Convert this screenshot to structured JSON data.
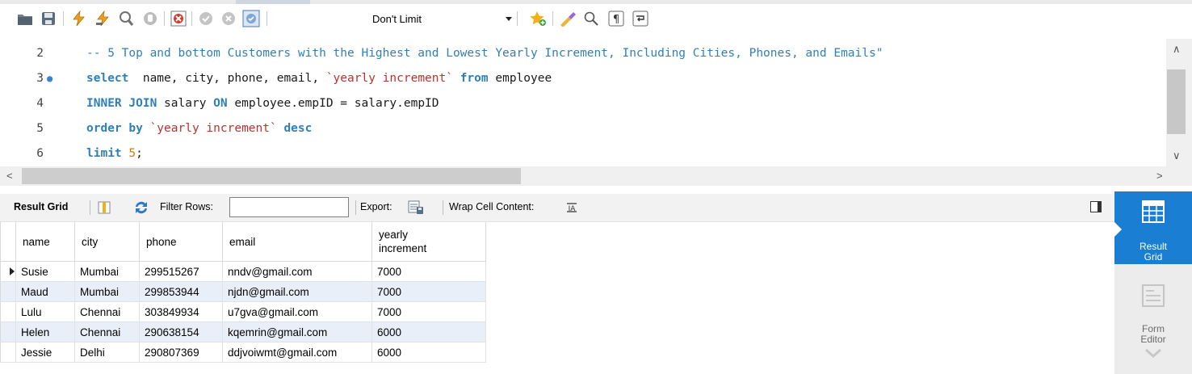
{
  "toolbar": {
    "limit_value": "Don't Limit",
    "icons": [
      "open-folder-icon",
      "save-icon",
      "execute-icon",
      "execute-current-icon",
      "explain-icon",
      "stop-icon",
      "toggle-error-icon",
      "commit-icon",
      "rollback-icon",
      "autocommit-icon",
      "favorite-icon",
      "beautify-icon",
      "find-icon",
      "invisible-chars-icon",
      "wrap-icon"
    ]
  },
  "editor": {
    "lines": [
      {
        "number": "2",
        "parts": [
          {
            "c": "cm",
            "t": "-- 5 Top and bottom Customers with the Highest and Lowest Yearly Increment, Including Cities, Phones, and Emails\""
          }
        ]
      },
      {
        "number": "3",
        "marker": "●",
        "parts": [
          {
            "c": "kw",
            "t": "select"
          },
          {
            "c": "tx",
            "t": "  name, city, phone, email, "
          },
          {
            "c": "st",
            "t": "`yearly increment`"
          },
          {
            "c": "tx",
            "t": " "
          },
          {
            "c": "kw",
            "t": "from"
          },
          {
            "c": "tx",
            "t": " employee"
          }
        ]
      },
      {
        "number": "4",
        "parts": [
          {
            "c": "kw",
            "t": "INNER JOIN"
          },
          {
            "c": "tx",
            "t": " salary "
          },
          {
            "c": "kw",
            "t": "ON"
          },
          {
            "c": "tx",
            "t": " employee.empID = salary.empID"
          }
        ]
      },
      {
        "number": "5",
        "parts": [
          {
            "c": "kw",
            "t": "order by"
          },
          {
            "c": "tx",
            "t": " "
          },
          {
            "c": "st",
            "t": "`yearly increment`"
          },
          {
            "c": "tx",
            "t": " "
          },
          {
            "c": "kw",
            "t": "desc"
          }
        ]
      },
      {
        "number": "6",
        "parts": [
          {
            "c": "kw",
            "t": "limit"
          },
          {
            "c": "tx",
            "t": " "
          },
          {
            "c": "nm",
            "t": "5"
          },
          {
            "c": "tx",
            "t": ";"
          }
        ]
      }
    ]
  },
  "result_toolbar": {
    "result_grid_label": "Result Grid",
    "filter_rows_label": "Filter Rows:",
    "filter_value": "",
    "export_label": "Export:",
    "wrap_label": "Wrap Cell Content:"
  },
  "grid": {
    "columns": [
      "name",
      "city",
      "phone",
      "email",
      "yearly\nincrement"
    ],
    "rows": [
      [
        "Susie",
        "Mumbai",
        "299515267",
        "nndv@gmail.com",
        "7000"
      ],
      [
        "Maud",
        "Mumbai",
        "299853944",
        "njdn@gmail.com",
        "7000"
      ],
      [
        "Lulu",
        "Chennai",
        "303849934",
        "u7gva@gmail.com",
        "7000"
      ],
      [
        "Helen",
        "Chennai",
        "290638154",
        "kqemrin@gmail.com",
        "6000"
      ],
      [
        "Jessie",
        "Delhi",
        "290807369",
        "ddjvoiwmt@gmail.com",
        "6000"
      ]
    ],
    "selected_row": 0
  },
  "side_panel": {
    "result_grid_label_1": "Result",
    "result_grid_label_2": "Grid",
    "form_editor_label_1": "Form",
    "form_editor_label_2": "Editor"
  },
  "colors": {
    "keyword": "#2f7fb8",
    "string": "#b7342e",
    "number": "#d87a00",
    "accent": "#1a7ed3",
    "row_alt": "#e9eff8"
  }
}
